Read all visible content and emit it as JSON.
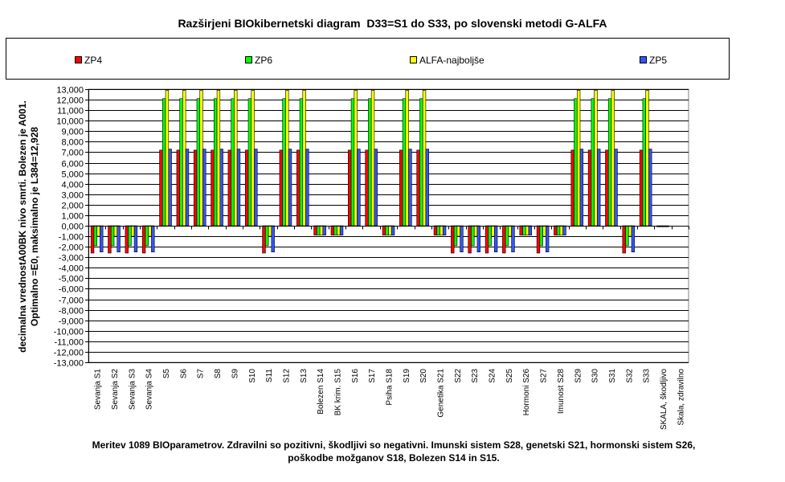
{
  "chart_data": {
    "type": "bar",
    "title": "Razširjeni BIOkibernetski diagram  D33=S1 do S33, po slovenski metodi G-ALFA",
    "ylabel_line1": "decimalna vrednostA00BK nivo smrti. Bolezen je A001.",
    "ylabel_line2": "Optimalno =E0, maksimalno je L384=12,928",
    "caption": "Meritev 1089 BIOparametrov. Zdravilni so pozitivni, škodljivi so negativni. Imunski sistem S28, genetski S21, hormonski sistem S26, poškodbe možganov S18, Bolezen S14 in S15.",
    "ylim": [
      -13000,
      13000
    ],
    "ytick_step": 1000,
    "ytick_labels": [
      "13,000",
      "12,000",
      "11,000",
      "10,000",
      "9,000",
      "8,000",
      "7,000",
      "6,000",
      "5,000",
      "4,000",
      "3,000",
      "2,000",
      "1,000",
      "0,000",
      "-1,000",
      "-2,000",
      "-3,000",
      "-4,000",
      "-5,000",
      "-6,000",
      "-7,000",
      "-8,000",
      "-9,000",
      "-10,000",
      "-11,000",
      "-12,000",
      "-13,000"
    ],
    "grid": true,
    "legend_position": "top",
    "categories": [
      "Sevanja S1",
      "Sevanja S2",
      "Sevanja S3",
      "Sevanja S4",
      "S5",
      "S6",
      "S7",
      "S8",
      "S9",
      "S10",
      "S11",
      "S12",
      "S13",
      "Bolezen S14",
      "BK krim. S15",
      "S16",
      "S17",
      "Psiha S18",
      "S19",
      "S20",
      "Genetika S21",
      "S22",
      "S23",
      "S24",
      "S25",
      "Hormoni S26",
      "S27",
      "Imunost S28",
      "S29",
      "S30",
      "S31",
      "S32",
      "S33",
      "SKALA, škodljivo",
      "Skala, zdravilno"
    ],
    "series": [
      {
        "name": "ZP4",
        "color": "#ff0000",
        "values": [
          -2600,
          -2600,
          -2600,
          -2600,
          7200,
          7200,
          7200,
          7200,
          7200,
          7200,
          -2600,
          7200,
          7200,
          -900,
          -900,
          7200,
          7200,
          -900,
          7200,
          7200,
          -900,
          -2600,
          -2600,
          -2600,
          -2600,
          -900,
          -2600,
          -900,
          7200,
          7200,
          7200,
          -2600,
          7200,
          -100,
          0
        ]
      },
      {
        "name": "ZP6",
        "color": "#00ff00",
        "values": [
          -1900,
          -1900,
          -1900,
          -1900,
          12100,
          12100,
          12100,
          12100,
          12100,
          12100,
          -1900,
          12100,
          12100,
          -900,
          -900,
          12100,
          12100,
          -900,
          12100,
          12100,
          -900,
          -1900,
          -1900,
          -1900,
          -1900,
          -900,
          -1900,
          -900,
          12100,
          12100,
          12100,
          -1900,
          12100,
          -100,
          0
        ]
      },
      {
        "name": "ALFA-najboljše",
        "color": "#ffff00",
        "values": [
          -1000,
          -1000,
          -1000,
          -1000,
          12900,
          12900,
          12900,
          12900,
          12900,
          12900,
          -1000,
          12900,
          12900,
          -900,
          -900,
          12900,
          12900,
          -900,
          12900,
          12900,
          -900,
          -1000,
          -1000,
          -1000,
          -1000,
          -900,
          -1000,
          -900,
          12900,
          12900,
          12900,
          -1000,
          12900,
          -100,
          0
        ]
      },
      {
        "name": "ZP5",
        "color": "#3355ff",
        "values": [
          -2500,
          -2500,
          -2500,
          -2500,
          7300,
          7300,
          7300,
          7300,
          7300,
          7300,
          -2500,
          7300,
          7300,
          -900,
          -900,
          7300,
          7300,
          -900,
          7300,
          7300,
          -900,
          -2500,
          -2500,
          -2500,
          -2500,
          -900,
          -2500,
          -900,
          7300,
          7300,
          7300,
          -2500,
          7300,
          -100,
          0
        ]
      }
    ]
  }
}
